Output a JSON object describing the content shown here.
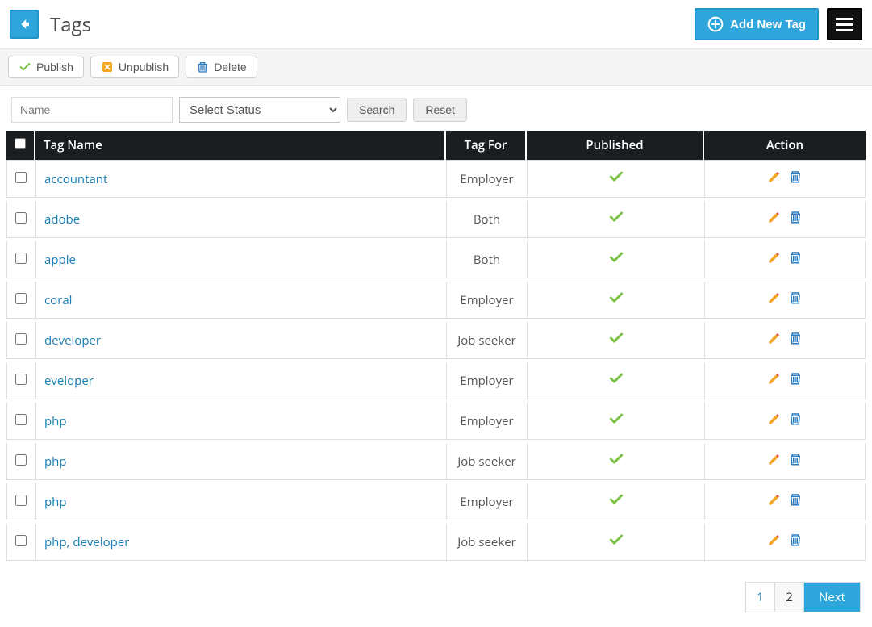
{
  "header": {
    "title": "Tags",
    "add_label": "Add New Tag"
  },
  "toolbar": {
    "publish_label": "Publish",
    "unpublish_label": "Unpublish",
    "delete_label": "Delete"
  },
  "filters": {
    "name_placeholder": "Name",
    "status_placeholder": "Select Status",
    "search_label": "Search",
    "reset_label": "Reset"
  },
  "table": {
    "headers": {
      "name": "Tag Name",
      "for": "Tag For",
      "published": "Published",
      "action": "Action"
    },
    "rows": [
      {
        "name": "accountant",
        "for": "Employer",
        "published": true
      },
      {
        "name": "adobe",
        "for": "Both",
        "published": true
      },
      {
        "name": "apple",
        "for": "Both",
        "published": true
      },
      {
        "name": "coral",
        "for": "Employer",
        "published": true
      },
      {
        "name": "developer",
        "for": "Job seeker",
        "published": true
      },
      {
        "name": "eveloper",
        "for": "Employer",
        "published": true
      },
      {
        "name": "php",
        "for": "Employer",
        "published": true
      },
      {
        "name": "php",
        "for": "Job seeker",
        "published": true
      },
      {
        "name": "php",
        "for": "Employer",
        "published": true
      },
      {
        "name": "php, developer",
        "for": "Job seeker",
        "published": true
      }
    ]
  },
  "pager": {
    "pages": [
      "1",
      "2"
    ],
    "current": "1",
    "next_label": "Next"
  },
  "icons": {
    "back": "back-arrow",
    "add": "plus-circle",
    "menu": "hamburger",
    "publish": "check",
    "unpublish": "x-square",
    "delete": "trash",
    "edit": "pencil",
    "row_delete": "trash"
  },
  "colors": {
    "accent": "#2ea6dc",
    "link": "#177fb5",
    "header_dark": "#1b1e21",
    "publish_green": "#7ac143",
    "unpublish_orange": "#f5a623",
    "delete_blue": "#2b7bbf"
  }
}
